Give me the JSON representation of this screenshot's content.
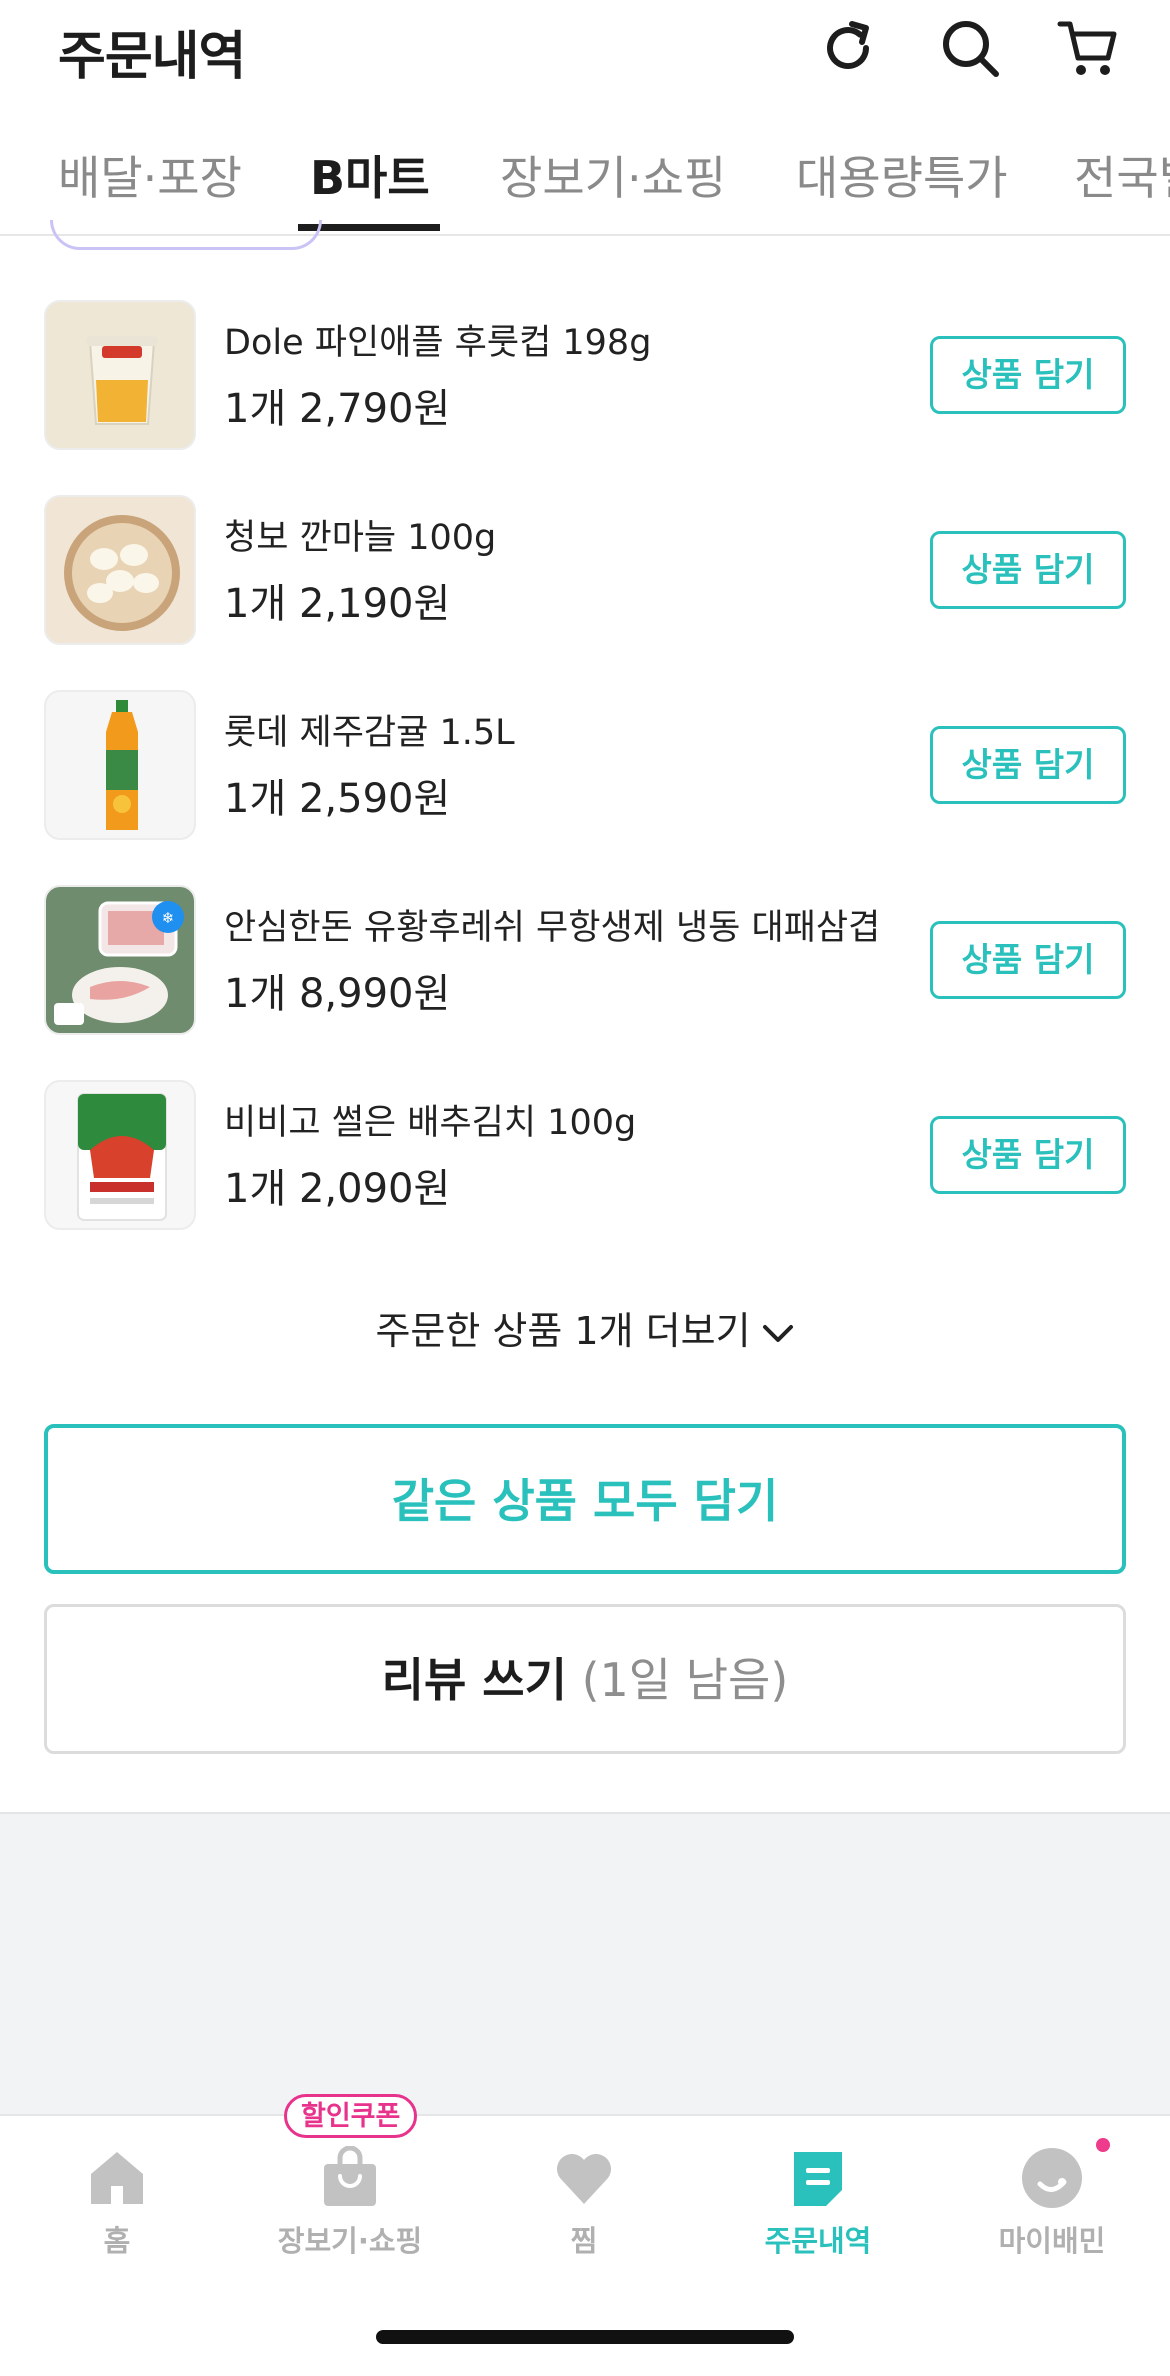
{
  "header": {
    "title": "주문내역",
    "icons": [
      "refresh-icon",
      "search-icon",
      "cart-icon"
    ]
  },
  "tabs": [
    {
      "label": "배달·포장",
      "active": false
    },
    {
      "label": "B마트",
      "active": true
    },
    {
      "label": "장보기·쇼핑",
      "active": false
    },
    {
      "label": "대용량특가",
      "active": false
    },
    {
      "label": "전국별",
      "active": false
    }
  ],
  "products": [
    {
      "name": "Dole 파인애플 후룻컵 198g",
      "price": "1개 2,790원",
      "button": "상품 담기"
    },
    {
      "name": "청보 깐마늘 100g",
      "price": "1개 2,190원",
      "button": "상품 담기"
    },
    {
      "name": "롯데 제주감귤 1.5L",
      "price": "1개 2,590원",
      "button": "상품 담기"
    },
    {
      "name": "안심한돈 유황후레쉬 무항생제 냉동 대패삼겹...",
      "price": "1개 8,990원",
      "button": "상품 담기",
      "badge": "냉동"
    },
    {
      "name": "비비고 썰은 배추김치 100g",
      "price": "1개 2,090원",
      "button": "상품 담기"
    }
  ],
  "more_label": "주문한 상품 1개 더보기",
  "add_all_label": "같은 상품 모두 담기",
  "review": {
    "label": "리뷰 쓰기",
    "remaining": "(1일 남음)"
  },
  "bottom_nav": [
    {
      "label": "홈",
      "icon": "home-icon",
      "active": false
    },
    {
      "label": "장보기·쇼핑",
      "icon": "shopping-bag-icon",
      "active": false,
      "badge": "할인쿠폰"
    },
    {
      "label": "찜",
      "icon": "heart-icon",
      "active": false
    },
    {
      "label": "주문내역",
      "icon": "order-list-icon",
      "active": true
    },
    {
      "label": "마이배민",
      "icon": "profile-icon",
      "active": false
    }
  ],
  "colors": {
    "accent": "#2ac1bc",
    "badge_pink": "#e8338c",
    "text": "#222222",
    "muted": "#8a8a8a"
  }
}
